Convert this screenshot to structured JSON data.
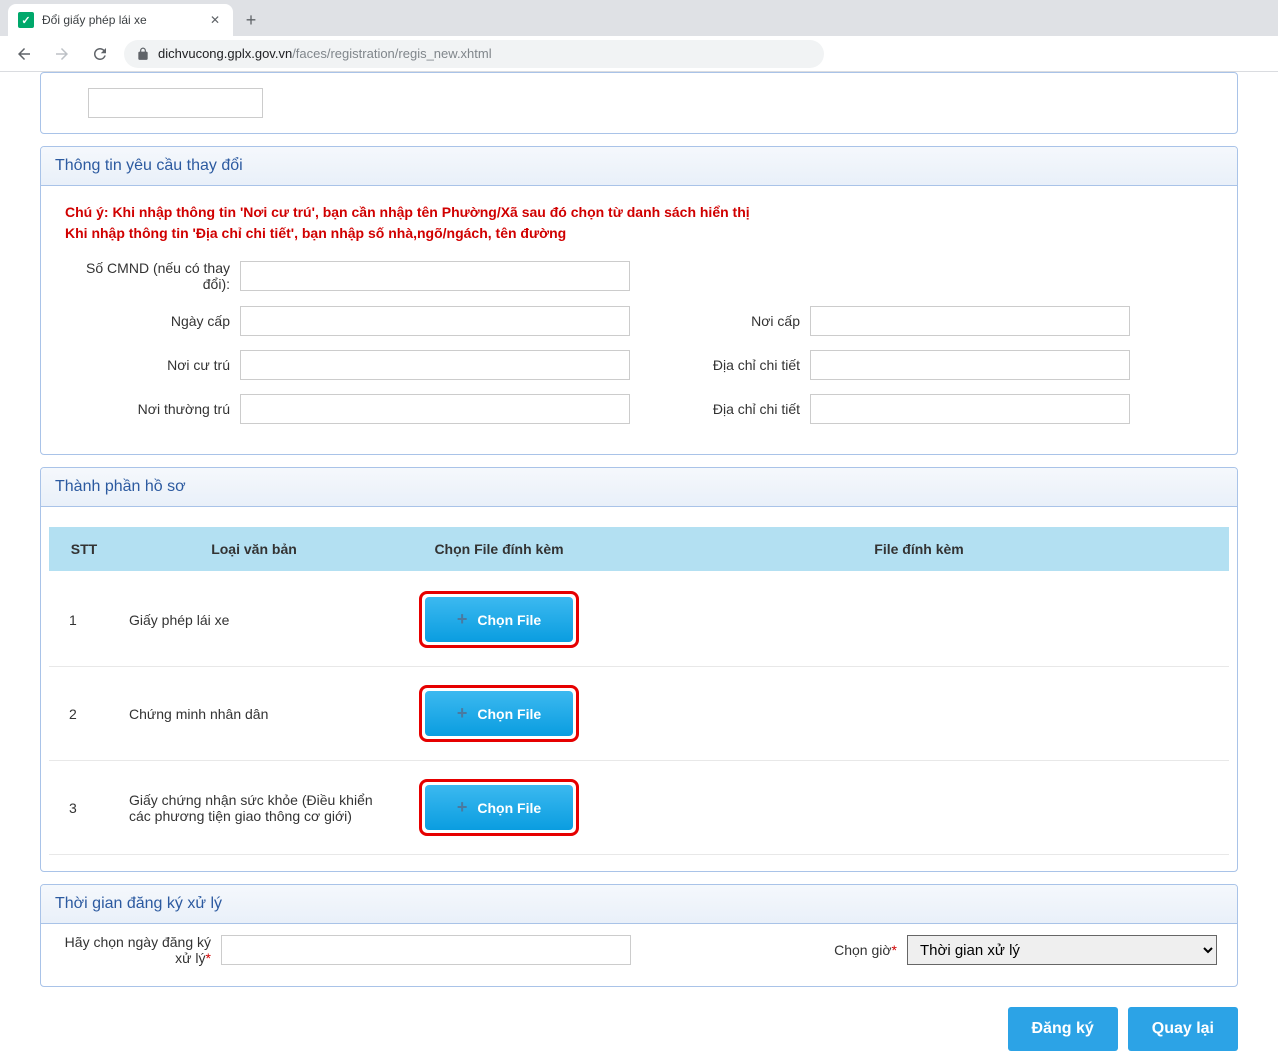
{
  "browser": {
    "tab_title": "Đổi giấy phép lái xe",
    "url_domain": "dichvucong.gplx.gov.vn",
    "url_path": "/faces/registration/regis_new.xhtml"
  },
  "panel1": {
    "title": "Thông tin yêu cầu thay đổi",
    "warning_line1": "Chú ý: Khi nhập thông tin 'Nơi cư trú', bạn cần nhập tên Phường/Xã sau đó chọn từ danh sách hiển thị",
    "warning_line2": "Khi nhập thông tin 'Địa chỉ chi tiết', bạn nhập số nhà,ngõ/ngách, tên đường",
    "labels": {
      "cmnd": "Số CMND (nếu có thay đổi):",
      "ngay_cap": "Ngày cấp",
      "noi_cap": "Nơi cấp",
      "noi_cu_tru": "Nơi cư trú",
      "dia_chi_1": "Địa chỉ chi tiết",
      "noi_thuong_tru": "Nơi thường trú",
      "dia_chi_2": "Địa chỉ chi tiết"
    }
  },
  "panel2": {
    "title": "Thành phần hồ sơ",
    "headers": {
      "stt": "STT",
      "loai": "Loại văn bản",
      "chon": "Chọn File đính kèm",
      "file": "File đính kèm"
    },
    "rows": [
      {
        "stt": "1",
        "name": "Giấy phép lái xe",
        "btn": "Chọn File"
      },
      {
        "stt": "2",
        "name": "Chứng minh nhân dân",
        "btn": "Chọn File"
      },
      {
        "stt": "3",
        "name": "Giấy chứng nhận sức khỏe (Điều khiển các phương tiện giao thông cơ giới)",
        "btn": "Chọn File"
      }
    ]
  },
  "panel3": {
    "title": "Thời gian đăng ký xử lý",
    "date_label": "Hãy chọn ngày đăng ký xử lý",
    "time_label": "Chọn giờ",
    "time_option": "Thời gian xử lý"
  },
  "footer": {
    "submit": "Đăng ký",
    "back": "Quay lại"
  }
}
